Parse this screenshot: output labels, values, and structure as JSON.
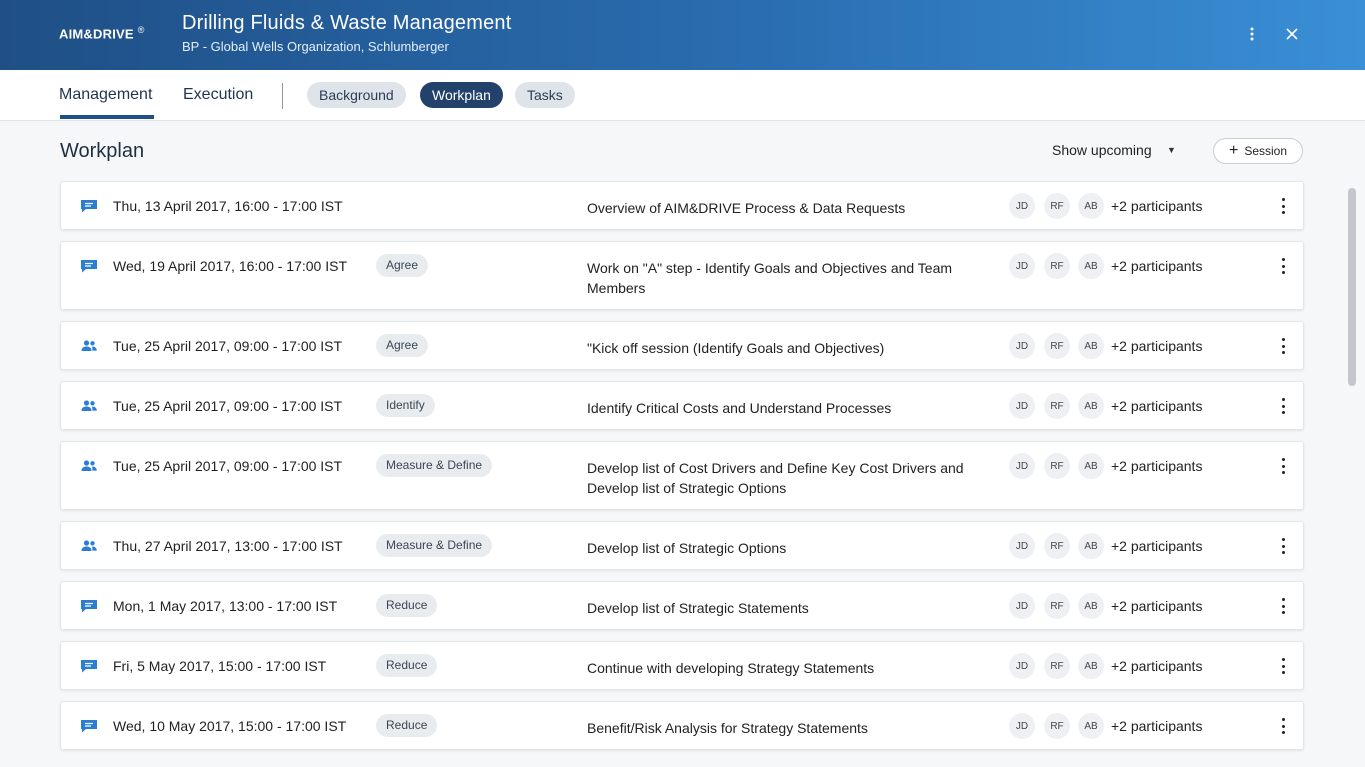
{
  "header": {
    "logo": "AIM&DRIVE",
    "logo_mark": "®",
    "title": "Drilling Fluids & Waste Management",
    "subtitle": "BP - Global Wells Organization, Schlumberger",
    "more_icon": "more-vertical-icon",
    "close_icon": "close-icon"
  },
  "nav": {
    "tabs": [
      "Management",
      "Execution"
    ],
    "active_tab": "Management",
    "pills": [
      "Background",
      "Workplan",
      "Tasks"
    ],
    "active_pill": "Workplan"
  },
  "workplan": {
    "title": "Workplan",
    "filter_label": "Show upcoming",
    "add_session_label": "Session"
  },
  "rows": [
    {
      "icon": "chat-icon",
      "date": "Thu, 13 April 2017, 16:00 - 17:00 IST",
      "tag": "",
      "title": "Overview of AIM&DRIVE Process & Data Requests",
      "avatars": [
        "JD",
        "RF",
        "AB"
      ],
      "participants": "+2 participants"
    },
    {
      "icon": "chat-icon",
      "date": "Wed, 19 April 2017, 16:00 - 17:00 IST",
      "tag": "Agree",
      "title": "Work on \"A\" step - Identify Goals and Objectives and Team Members",
      "avatars": [
        "JD",
        "RF",
        "AB"
      ],
      "participants": "+2 participants"
    },
    {
      "icon": "people-icon",
      "date": "Tue, 25 April 2017, 09:00 - 17:00 IST",
      "tag": "Agree",
      "title": "\"Kick off session (Identify Goals and Objectives)",
      "avatars": [
        "JD",
        "RF",
        "AB"
      ],
      "participants": "+2 participants"
    },
    {
      "icon": "people-icon",
      "date": "Tue, 25 April 2017, 09:00 - 17:00 IST",
      "tag": "Identify",
      "title": "Identify Critical Costs and Understand Processes",
      "avatars": [
        "JD",
        "RF",
        "AB"
      ],
      "participants": "+2 participants"
    },
    {
      "icon": "people-icon",
      "date": "Tue, 25 April 2017, 09:00 - 17:00 IST",
      "tag": "Measure & Define",
      "title": "Develop list of Cost Drivers and Define Key Cost Drivers and Develop list of Strategic Options",
      "avatars": [
        "JD",
        "RF",
        "AB"
      ],
      "participants": "+2 participants"
    },
    {
      "icon": "people-icon",
      "date": "Thu, 27 April 2017, 13:00 - 17:00 IST",
      "tag": "Measure & Define",
      "title": "Develop list of Strategic Options",
      "avatars": [
        "JD",
        "RF",
        "AB"
      ],
      "participants": "+2 participants"
    },
    {
      "icon": "chat-icon",
      "date": "Mon, 1 May 2017, 13:00 - 17:00 IST",
      "tag": "Reduce",
      "title": "Develop list of Strategic Statements",
      "avatars": [
        "JD",
        "RF",
        "AB"
      ],
      "participants": "+2 participants"
    },
    {
      "icon": "chat-icon",
      "date": "Fri, 5 May 2017, 15:00 - 17:00 IST",
      "tag": "Reduce",
      "title": "Continue with developing Strategy Statements",
      "avatars": [
        "JD",
        "RF",
        "AB"
      ],
      "participants": "+2 participants"
    },
    {
      "icon": "chat-icon",
      "date": "Wed, 10 May 2017, 15:00 - 17:00 IST",
      "tag": "Reduce",
      "title": "Benefit/Risk Analysis for Strategy Statements",
      "avatars": [
        "JD",
        "RF",
        "AB"
      ],
      "participants": "+2 participants"
    }
  ],
  "colors": {
    "header_start": "#1f4f86",
    "header_end": "#3a8fd6",
    "accent": "#1f4f86",
    "icon": "#2a7fd4"
  }
}
